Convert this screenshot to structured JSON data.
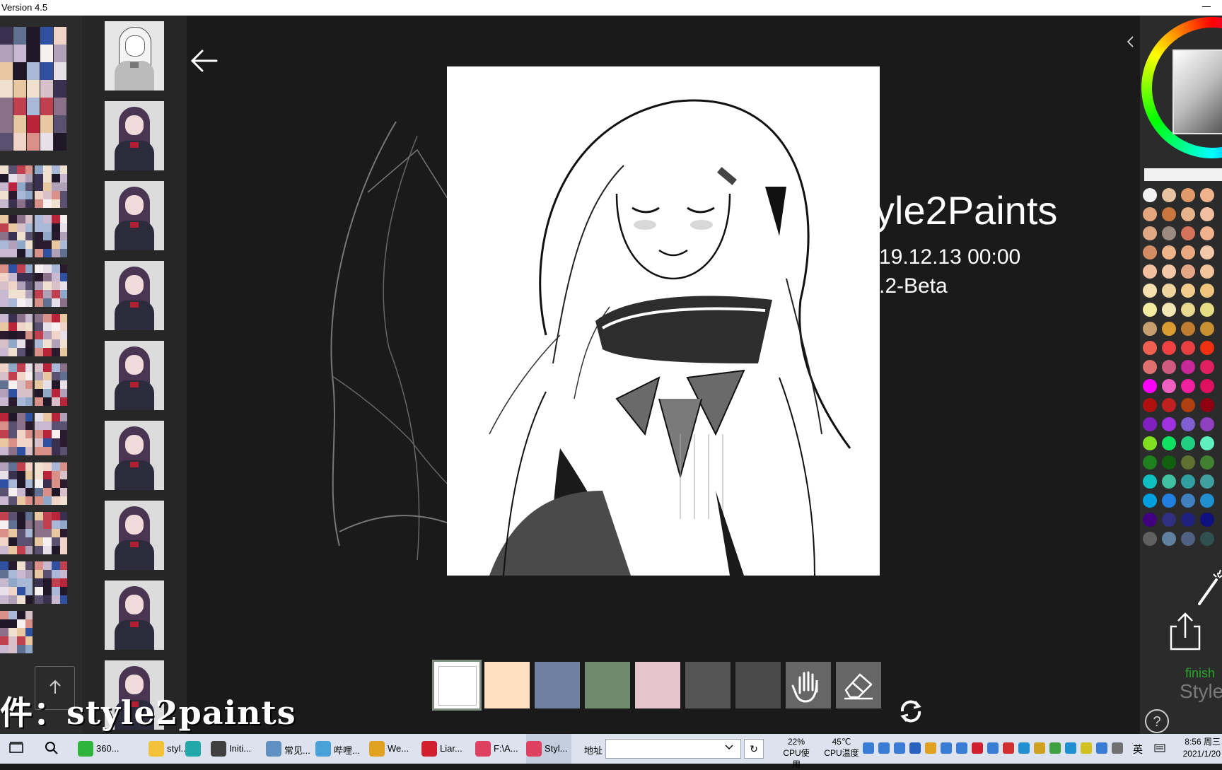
{
  "window": {
    "title": "Version 4.5"
  },
  "intro": {
    "title": "yle2Paints",
    "date": "19.12.13 00:00",
    "version": ".2-Beta"
  },
  "right_panel": {
    "finish_label": "finish",
    "style_label": "Style"
  },
  "watermark": {
    "text": "件：style2paints"
  },
  "colors": {
    "swatch_rows": [
      [
        "#f2f2f2",
        "#e6c2a0",
        "#e09a6c",
        "#f0b28c",
        "#f0c0a0"
      ],
      [
        "#e4a67c",
        "#c9773e",
        "#e8b48c",
        "#f0c0a0",
        "#f5d0b8"
      ],
      [
        "#e0a884",
        "#9a8a80",
        "#d4745a",
        "#f0b28c",
        "#f7d6d6"
      ],
      [
        "#d48c62",
        "#f0b48a",
        "#e8a880",
        "#f2c8a8",
        "#f0c0a0"
      ],
      [
        "#f2c0a0",
        "#f3c8a8",
        "#e4a888",
        "#f2c49c",
        "#f4d4bc"
      ],
      [
        "#f6e0b0",
        "#f0d4a0",
        "#f2cc8c",
        "#f0c47c",
        "#e8e0a0"
      ],
      [
        "#f4eca0",
        "#f2e6b4",
        "#e8d890",
        "#e6dc84",
        "#f0e8a0"
      ],
      [
        "#c8a070",
        "#d89c30",
        "#c07c30",
        "#c89030",
        "#c0a040"
      ],
      [
        "#f06050",
        "#f04040",
        "#e84040",
        "#f03010",
        "#e04020"
      ],
      [
        "#e07070",
        "#d05a80",
        "#c8289a",
        "#e02060",
        "#d04060"
      ],
      [
        "#ff00ff",
        "#f060c0",
        "#f020a0",
        "#e01060",
        "#f06090"
      ],
      [
        "#b01010",
        "#c02020",
        "#b04010",
        "#900010",
        "#a01010"
      ],
      [
        "#8020c0",
        "#a030e0",
        "#8060d0",
        "#9040c0",
        "#a040d0"
      ],
      [
        "#80e020",
        "#10e060",
        "#20d080",
        "#60f0c0",
        "#40e080"
      ],
      [
        "#208020",
        "#106010",
        "#607030",
        "#408030",
        "#50a030"
      ],
      [
        "#10c0c0",
        "#40c0a0",
        "#30a0a0",
        "#40a0a0",
        "#2090a0"
      ],
      [
        "#00a0e0",
        "#2080e0",
        "#4080c0",
        "#2090d0",
        "#50a0e0"
      ],
      [
        "#400080",
        "#303080",
        "#202080",
        "#101080",
        "#303090"
      ],
      [
        "#606060",
        "#6080a0",
        "#506080",
        "#305050",
        "#6080a0"
      ]
    ],
    "hint_chips": [
      "#ffffff",
      "#ffe0c0",
      "#7080a0",
      "#6f8a6c",
      "#e6c4cc",
      "#555555",
      "#4a4a4a"
    ]
  },
  "icons": {
    "back": "arrow-left-icon",
    "collapse": "chevron-left-icon",
    "hand": "hand-icon",
    "eraser": "eraser-icon",
    "refresh": "refresh-icon",
    "magic": "magic-wand-icon",
    "share": "share-icon",
    "help": "help-icon"
  },
  "taskbar": {
    "items": [
      {
        "label": "360...",
        "color": "#2fb43c"
      },
      {
        "label": "styl...",
        "color": "#f2c238"
      },
      {
        "label": "",
        "color": "#22a8a8"
      },
      {
        "label": "Initi...",
        "color": "#404040"
      },
      {
        "label": "常见...",
        "color": "#6090c0"
      },
      {
        "label": "哔哩...",
        "color": "#4aa0d8"
      },
      {
        "label": "We...",
        "color": "#e0a020"
      },
      {
        "label": "Liar...",
        "color": "#d02030"
      },
      {
        "label": "F:\\A...",
        "color": "#e04060"
      },
      {
        "label": "Styl...",
        "color": "#e04060"
      }
    ],
    "address_label": "地址",
    "cpu_usage": "22%",
    "cpu_usage_label": "CPU使用",
    "cpu_temp": "45℃",
    "cpu_temp_label": "CPU温度",
    "ime": "英",
    "time": "8:56 周三",
    "date": "2021/1/20"
  }
}
